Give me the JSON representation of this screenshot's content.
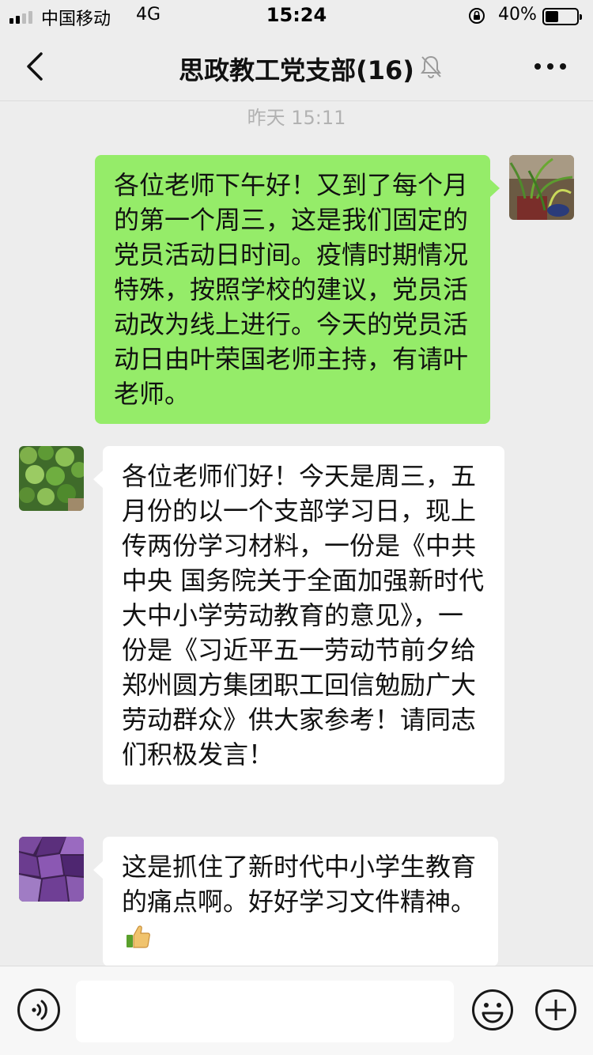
{
  "status_bar": {
    "carrier": "中国移动",
    "network": "4G",
    "time": "15:24",
    "battery_percent": "40%",
    "battery_level": 0.4,
    "signal_strength": 2
  },
  "nav": {
    "title": "思政教工党支部(16)",
    "muted": true
  },
  "chat": {
    "timestamp": "昨天 15:11",
    "messages": [
      {
        "sender": "self",
        "text": "各位老师下午好！又到了每个月的第一个周三，这是我们固定的党员活动日时间。疫情时期情况特殊，按照学校的建议，党员活动改为线上进行。今天的党员活动日由叶荣国老师主持，有请叶老师。"
      },
      {
        "sender": "other",
        "text": "各位老师们好！今天是周三，五月份的以一个支部学习日，现上传两份学习材料，一份是《中共中央 国务院关于全面加强新时代大中小学劳动教育的意见》，一份是《习近平五一劳动节前夕给郑州圆方集团职工回信勉励广大劳动群众》供大家参考！请同志们积极发言！"
      },
      {
        "sender": "other",
        "text": "这是抓住了新时代中小学生教育的痛点啊。好好学习文件精神。",
        "emoji": "thumbs-up"
      }
    ]
  },
  "input": {
    "placeholder": "",
    "value": ""
  },
  "colors": {
    "background": "#ededed",
    "self_bubble": "#95ec69",
    "other_bubble": "#ffffff",
    "timestamp": "#b2b2b2"
  },
  "icons": [
    "back-arrow-icon",
    "mute-bell-icon",
    "more-icon",
    "voice-icon",
    "emoji-icon",
    "plus-icon",
    "lock-rotation-icon",
    "battery-icon",
    "thumbs-up-icon"
  ]
}
